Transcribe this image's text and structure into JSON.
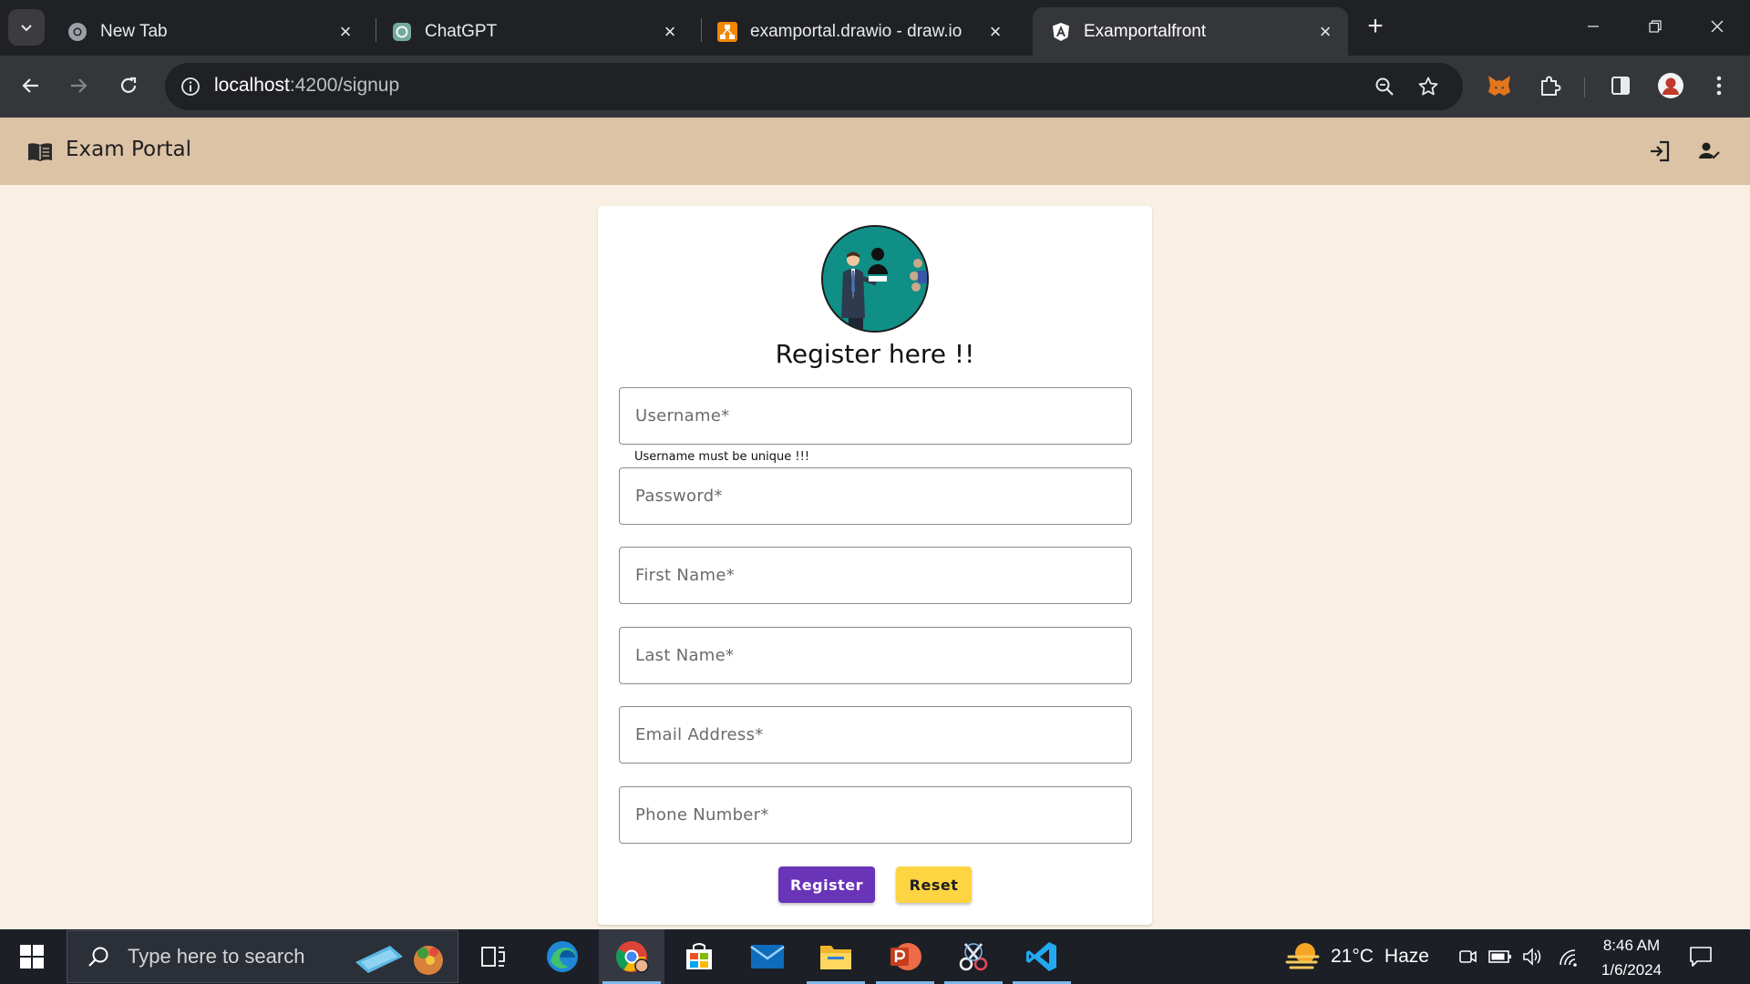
{
  "browser": {
    "tabs": [
      {
        "title": "New Tab",
        "icon": "chrome-icon",
        "active": false
      },
      {
        "title": "ChatGPT",
        "icon": "chatgpt-icon",
        "active": false
      },
      {
        "title": "examportal.drawio - draw.io",
        "icon": "drawio-icon",
        "active": false
      },
      {
        "title": "Examportalfront",
        "icon": "angular-icon",
        "active": true
      }
    ],
    "url_host": "localhost",
    "url_path": ":4200/signup"
  },
  "app": {
    "title": "Exam Portal",
    "header_icons": [
      "login-icon",
      "register-icon"
    ]
  },
  "signup": {
    "heading": "Register here !!",
    "fields": {
      "username": "Username*",
      "password": "Password*",
      "first_name": "First Name*",
      "last_name": "Last Name*",
      "email": "Email Address*",
      "phone": "Phone Number*"
    },
    "username_hint": "Username must be unique !!!",
    "register_label": "Register",
    "reset_label": "Reset"
  },
  "taskbar": {
    "search_placeholder": "Type here to search",
    "weather_temp": "21°C",
    "weather_desc": "Haze",
    "time": "8:46 AM",
    "date": "1/6/2024"
  },
  "colors": {
    "app_header": "#dcc3a6",
    "page_background": "#f9efe3",
    "register_button": "#6a34b9",
    "reset_button": "#fdd441"
  }
}
